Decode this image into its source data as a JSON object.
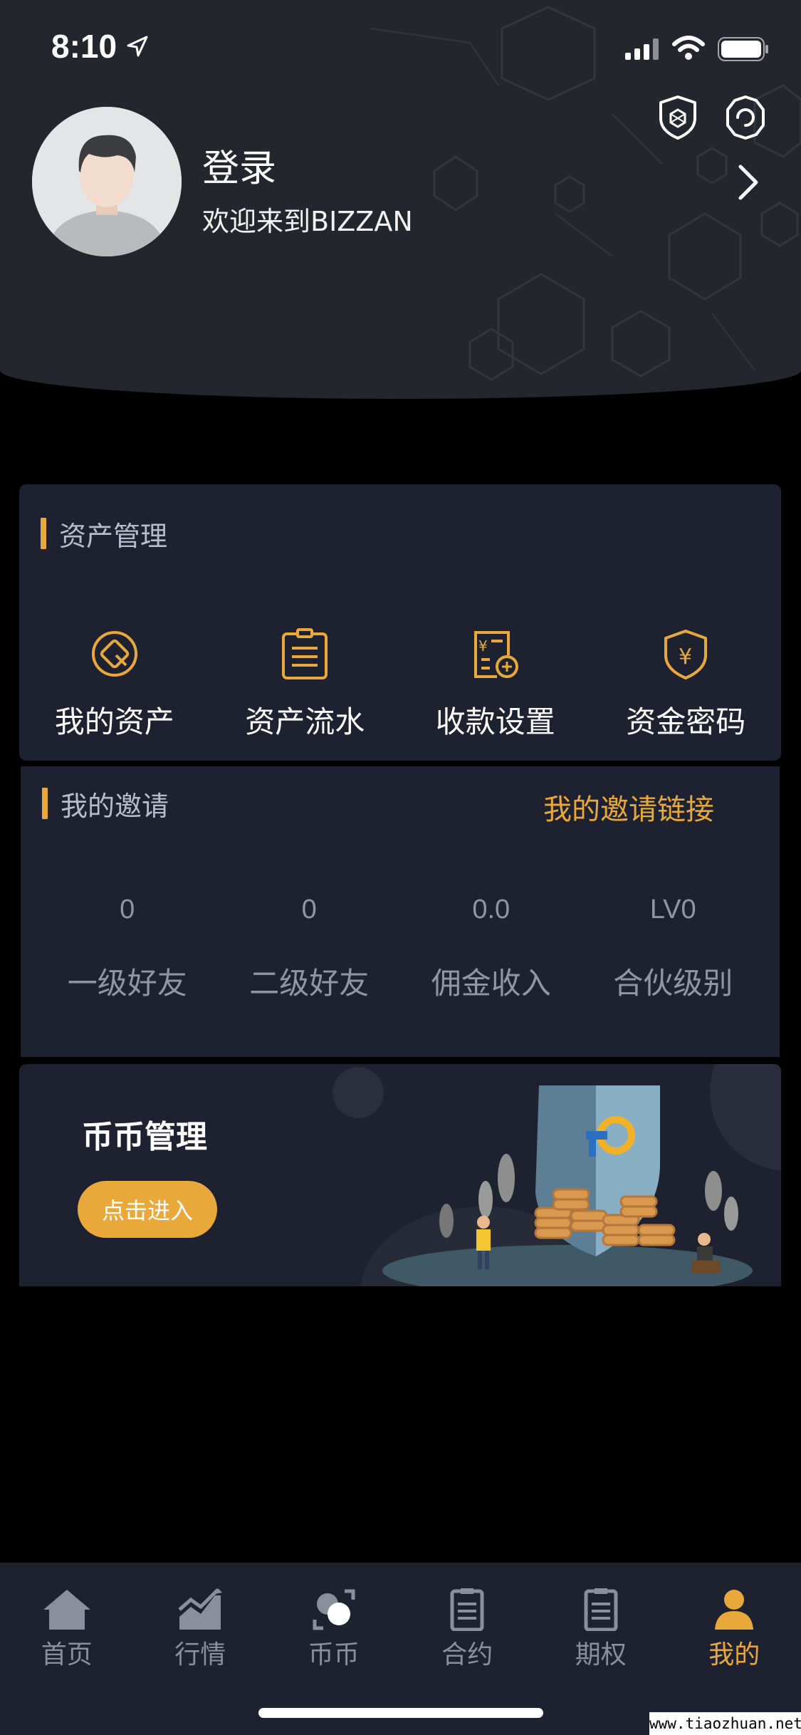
{
  "status_bar": {
    "time": "8:10",
    "icons": [
      "location-arrow-icon",
      "signal-icon",
      "wifi-icon",
      "battery-icon"
    ]
  },
  "header": {
    "login_title": "登录",
    "welcome_text": "欢迎来到BIZZAN",
    "icons": [
      "shield-icon",
      "gear-icon",
      "chevron-right-icon"
    ]
  },
  "assets": {
    "title": "资产管理",
    "items": [
      {
        "label": "我的资产",
        "icon": "asset-circle-icon"
      },
      {
        "label": "资产流水",
        "icon": "clipboard-icon"
      },
      {
        "label": "收款设置",
        "icon": "payment-settings-icon"
      },
      {
        "label": "资金密码",
        "icon": "yuan-shield-icon"
      }
    ]
  },
  "invite": {
    "title": "我的邀请",
    "link_label": "我的邀请链接",
    "stats": [
      {
        "value": "0",
        "label": "一级好友"
      },
      {
        "value": "0",
        "label": "二级好友"
      },
      {
        "value": "0.0",
        "label": "佣金收入"
      },
      {
        "value": "LV0",
        "label": "合伙级别"
      }
    ]
  },
  "coin_management": {
    "title": "币币管理",
    "button_label": "点击进入"
  },
  "tabbar": {
    "items": [
      {
        "label": "首页",
        "icon": "home-icon",
        "active": false
      },
      {
        "label": "行情",
        "icon": "market-chart-icon",
        "active": false
      },
      {
        "label": "币币",
        "icon": "coin-exchange-icon",
        "active": false
      },
      {
        "label": "合约",
        "icon": "contract-doc-icon",
        "active": false
      },
      {
        "label": "期权",
        "icon": "options-doc-icon",
        "active": false
      },
      {
        "label": "我的",
        "icon": "profile-icon",
        "active": true
      }
    ]
  },
  "colors": {
    "accent": "#e9a93a",
    "card_bg": "#1e2230",
    "header_bg": "#24262d",
    "page_bg": "#000000"
  },
  "watermark": "www.tiaozhuan.net"
}
